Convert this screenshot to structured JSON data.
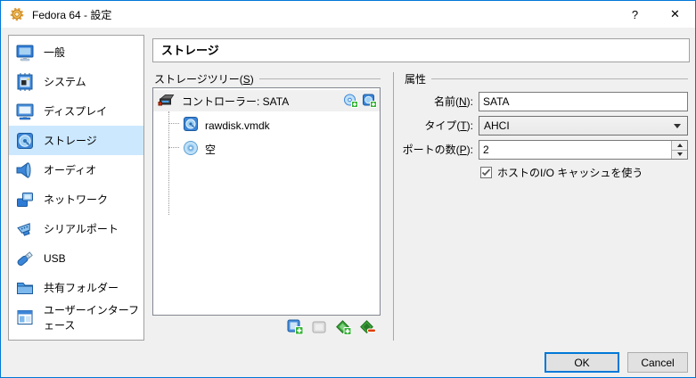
{
  "window": {
    "title": "Fedora 64 - 設定",
    "help_label": "?",
    "close_label": "✕"
  },
  "sidebar": {
    "items": [
      {
        "label": "一般",
        "icon": "general-icon"
      },
      {
        "label": "システム",
        "icon": "system-icon"
      },
      {
        "label": "ディスプレイ",
        "icon": "display-icon"
      },
      {
        "label": "ストレージ",
        "icon": "storage-icon",
        "selected": true
      },
      {
        "label": "オーディオ",
        "icon": "audio-icon"
      },
      {
        "label": "ネットワーク",
        "icon": "network-icon"
      },
      {
        "label": "シリアルポート",
        "icon": "serial-port-icon"
      },
      {
        "label": "USB",
        "icon": "usb-icon"
      },
      {
        "label": "共有フォルダー",
        "icon": "shared-folders-icon"
      },
      {
        "label": "ユーザーインターフェース",
        "icon": "user-interface-icon"
      }
    ]
  },
  "page": {
    "title": "ストレージ"
  },
  "storage_tree": {
    "group_label": "ストレージツリー(S)",
    "controller_label": "コントローラー: SATA",
    "attachments": [
      {
        "label": "rawdisk.vmdk",
        "icon": "hard-disk-icon"
      },
      {
        "label": "空",
        "icon": "optical-disc-icon"
      }
    ]
  },
  "attributes": {
    "group_label": "属性",
    "name_label": "名前(N):",
    "name_value": "SATA",
    "type_label": "タイプ(T):",
    "type_value": "AHCI",
    "ports_label": "ポートの数(P):",
    "ports_value": "2",
    "host_cache_label": "ホストのI/O キャッシュを使う",
    "host_cache_checked": true
  },
  "footer": {
    "ok_label": "OK",
    "cancel_label": "Cancel"
  },
  "colors": {
    "accent": "#0078d7",
    "selection": "#cce8ff",
    "window_bg": "#f0f0f0"
  }
}
